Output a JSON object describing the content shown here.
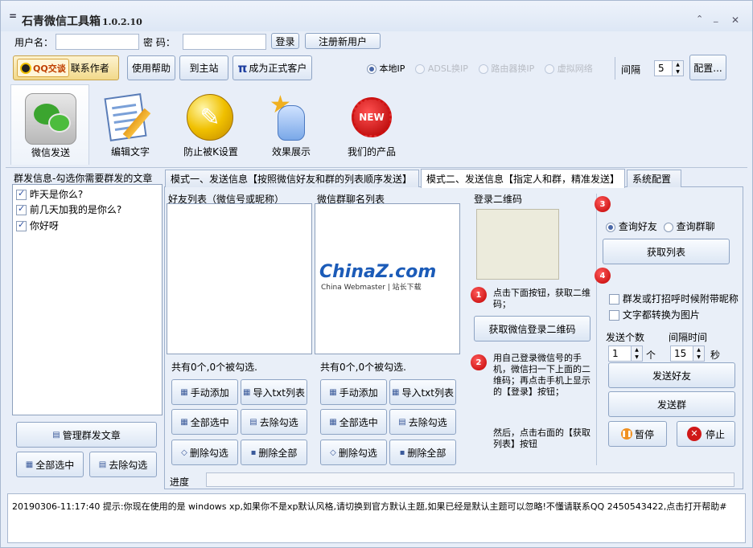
{
  "window": {
    "title": "石青微信工具箱",
    "version": "1.0.2.10",
    "controls": [
      "⌃",
      "_",
      "✕"
    ]
  },
  "login": {
    "username_label": "用户名：",
    "password_label": "密  码：",
    "login_button": "登录",
    "register_button": "注册新用户"
  },
  "toolbar": {
    "qq_button": "QQ交谈",
    "contact_author": "联系作者",
    "help": "使用帮助",
    "home": "到主站",
    "become_customer": "成为正式客户",
    "pi": "π"
  },
  "network": {
    "options": [
      "本地IP",
      "ADSL换IP",
      "路由器换IP",
      "虚拟网络"
    ],
    "selected": "本地IP",
    "interval_label": "间隔",
    "interval_value": "5",
    "config_button": "配置..."
  },
  "tools": [
    {
      "label": "微信发送",
      "icon": "wechat-icon"
    },
    {
      "label": "编辑文字",
      "icon": "edit-doc-icon"
    },
    {
      "label": "防止被K设置",
      "icon": "wrench-icon"
    },
    {
      "label": "效果展示",
      "icon": "hand-star-icon"
    },
    {
      "label": "我们的产品",
      "icon": "new-badge-icon",
      "badge": "NEW"
    }
  ],
  "left": {
    "title": "群发信息-勾选你需要群发的文章",
    "articles": [
      {
        "text": "昨天是你么?",
        "checked": true
      },
      {
        "text": "前几天加我的是你么?",
        "checked": true
      },
      {
        "text": "你好呀",
        "checked": true
      }
    ],
    "manage_button": "管理群发文章",
    "select_all": "全部选中",
    "deselect": "去除勾选"
  },
  "tabs": [
    "模式一、发送信息【按照微信好友和群的列表顺序发送】",
    "模式二、发送信息【指定人和群，精准发送】",
    "系统配置"
  ],
  "friends": {
    "title": "好友列表（微信号或昵称）",
    "count": "共有0个,0个被勾选.",
    "manual_add": "手动添加",
    "import_txt": "导入txt列表",
    "select_all": "全部选中",
    "deselect": "去除勾选",
    "delete_checked": "删除勾选",
    "delete_all": "删除全部"
  },
  "groups": {
    "title": "微信群聊名列表",
    "count": "共有0个,0个被勾选.",
    "manual_add": "手动添加",
    "import_txt": "导入txt列表",
    "select_all": "全部选中",
    "deselect": "去除勾选",
    "delete_checked": "删除勾选",
    "delete_all": "删除全部"
  },
  "watermark": {
    "line1": "ChinaZ.com",
    "line2": "China Webmaster | 站长下载"
  },
  "qr": {
    "title": "登录二维码",
    "step1": "点击下面按钮，获取二维码；",
    "get_qr_button": "获取微信登录二维码",
    "step2": "用自己登录微信号的手机，微信扫一下上面的二维码；再点击手机上显示的【登录】按钮；",
    "step2b": "然后，点击右面的【获取列表】按钮"
  },
  "right": {
    "query_friends": "查询好友",
    "query_groups": "查询群聊",
    "get_list": "获取列表",
    "opt_nickname": "群发或打招呼时候附带昵称",
    "opt_image": "文字都转换为图片",
    "send_count_label": "发送个数",
    "interval_label": "间隔时间",
    "send_count": "1",
    "unit_count": "个",
    "interval": "15",
    "unit_sec": "秒",
    "send_friends": "发送好友",
    "send_groups": "发送群",
    "pause": "暂停",
    "stop": "停止"
  },
  "steps": [
    "1",
    "2",
    "3",
    "4"
  ],
  "progress": {
    "label": "进度",
    "value": 0
  },
  "status": {
    "text": "20190306-11:17:40  提示:你现在使用的是 windows xp,如果你不是xp默认风格,请切换到官方默认主题,如果已经是默认主题可以忽略!不懂请联系QQ 2450543422,点击打开帮助#"
  }
}
